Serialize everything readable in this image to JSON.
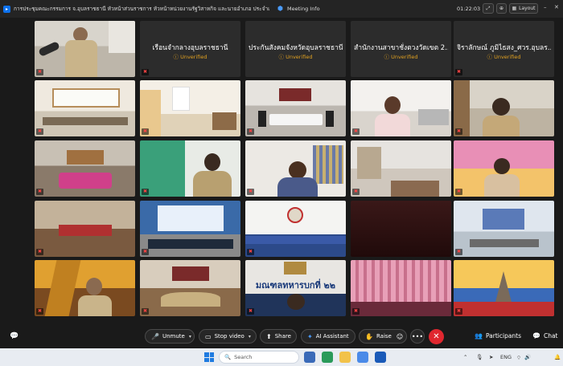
{
  "window": {
    "title": "การประชุมคณะกรรมการ จ.อุบลราชธานี หัวหน้าส่วนราชการ หัวหน้าหน่วยงานรัฐวิสาหกิจ และนายอำเภอ ประจำเดือนเมษายน 2569",
    "meeting_info_label": "Meeting Info",
    "timer": "01:22:03",
    "layout_label": "Layout"
  },
  "participants": [
    {
      "name": "เรือนจำกลางอุบลราชธานี",
      "status": "Unverified"
    },
    {
      "name": "ประกันสังคมจังหวัดอุบลราชธานี",
      "status": "Unverified"
    },
    {
      "name": "สำนักงานสาขาชั่งตวงวัดเขต 2...",
      "status": "Unverified"
    },
    {
      "name": "จิราลักษณ์ ภูมิไธสง_ศวร.อุบลร...",
      "status": "Unverified"
    }
  ],
  "video_signs": {
    "mandala": "มณฑลทหารบกที่ ๒๒"
  },
  "toolbar": {
    "unmute": "Unmute",
    "stop_video": "Stop video",
    "share": "Share",
    "ai_assistant": "AI Assistant",
    "raise": "Raise",
    "participants": "Participants",
    "chat": "Chat"
  },
  "taskbar": {
    "search_placeholder": "Search",
    "lang": "ENG"
  },
  "colors": {
    "accent": "#0e72ed",
    "unverified": "#e0a020",
    "end_button": "#e0272f"
  }
}
